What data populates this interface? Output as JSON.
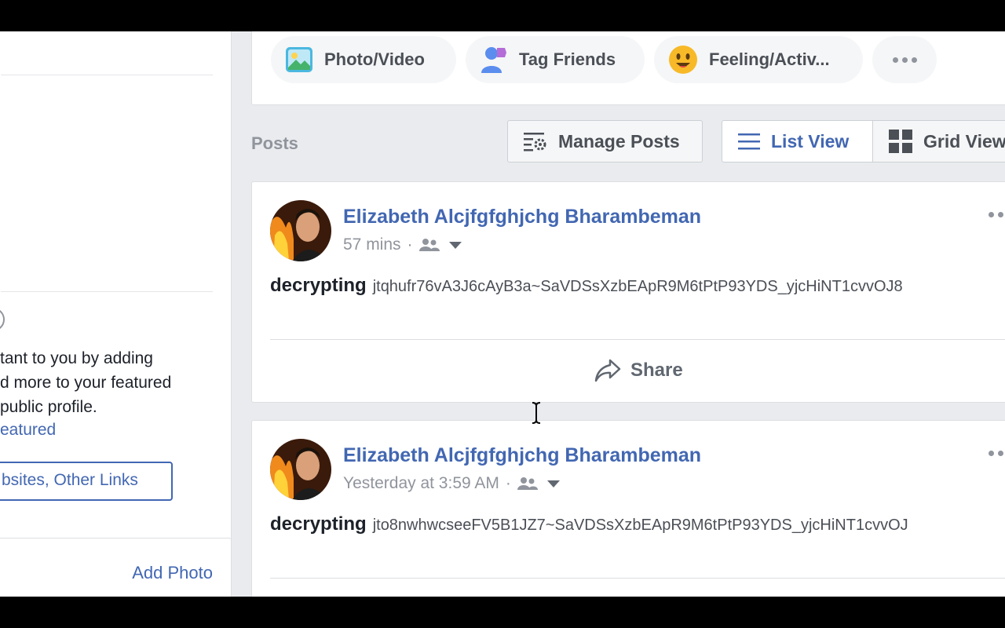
{
  "composer": {
    "photo_video": "Photo/Video",
    "tag_friends": "Tag Friends",
    "feeling": "Feeling/Activ..."
  },
  "left": {
    "featured_lines": [
      "tant to you by adding",
      "d more to your featured",
      "public profile."
    ],
    "featured_link": "eatured",
    "links_button": "bsites, Other Links",
    "add_photo": "Add Photo"
  },
  "toolbar": {
    "posts_label": "Posts",
    "manage_posts": "Manage Posts",
    "list_view": "List View",
    "grid_view": "Grid View"
  },
  "posts": [
    {
      "author": "Elizabeth Alcjfgfghjchg Bharambeman",
      "time": "57 mins",
      "keyword": "decrypting",
      "code": "jtqhufr76vA3J6cAyB3a~SaVDSsXzbEApR9M6tPtP93YDS_yjcHiNT1cvvOJ8",
      "share_label": "Share"
    },
    {
      "author": "Elizabeth Alcjfgfghjchg Bharambeman",
      "time": "Yesterday at 3:59 AM",
      "keyword": "decrypting",
      "code": "jto8nwhwcseeFV5B1JZ7~SaVDSsXzbEApR9M6tPtP93YDS_yjcHiNT1cvvOJ"
    }
  ],
  "colors": {
    "link": "#4267b2",
    "muted": "#90949c",
    "background": "#e9ebee"
  }
}
